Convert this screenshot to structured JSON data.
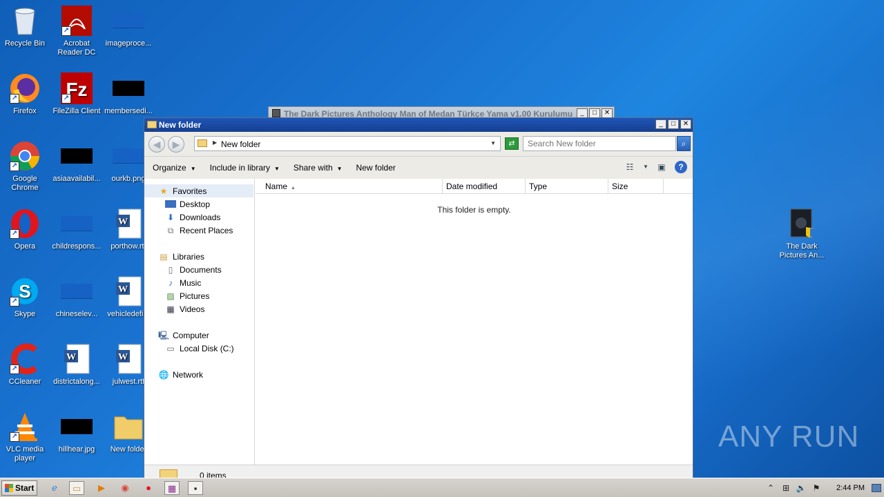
{
  "desktop": {
    "icons": [
      {
        "label": "Recycle Bin",
        "icon": "recycle-bin-icon"
      },
      {
        "label": "Acrobat Reader DC",
        "icon": "acrobat-icon"
      },
      {
        "label": "imageproce...",
        "icon": "file-icon"
      },
      {
        "label": "Firefox",
        "icon": "firefox-icon"
      },
      {
        "label": "FileZilla Client",
        "icon": "filezilla-icon"
      },
      {
        "label": "membersedi...",
        "icon": "file-icon"
      },
      {
        "label": "Google Chrome",
        "icon": "chrome-icon"
      },
      {
        "label": "asiaavailabil...",
        "icon": "file-icon"
      },
      {
        "label": "ourkb.png",
        "icon": "file-icon"
      },
      {
        "label": "Opera",
        "icon": "opera-icon"
      },
      {
        "label": "childrespons...",
        "icon": "file-icon"
      },
      {
        "label": "porthow.rtf",
        "icon": "word-doc-icon"
      },
      {
        "label": "Skype",
        "icon": "skype-icon"
      },
      {
        "label": "chineselev...",
        "icon": "file-icon"
      },
      {
        "label": "vehicledefi...",
        "icon": "word-doc-icon"
      },
      {
        "label": "CCleaner",
        "icon": "ccleaner-icon"
      },
      {
        "label": "districtalong...",
        "icon": "word-doc-icon"
      },
      {
        "label": "julwest.rtf",
        "icon": "word-doc-icon"
      },
      {
        "label": "VLC media player",
        "icon": "vlc-icon"
      },
      {
        "label": "hillhear.jpg",
        "icon": "image-icon"
      },
      {
        "label": "New folder",
        "icon": "folder-icon"
      },
      {
        "label": "The Dark Pictures An...",
        "icon": "installer-icon"
      }
    ],
    "watermark": "ANY RUN"
  },
  "background_window": {
    "title": "The Dark Pictures Anthology Man of Medan Türkçe Yama v1.00 Kurulumu"
  },
  "explorer": {
    "title": "New folder",
    "address": "New folder",
    "search_placeholder": "Search New folder",
    "toolbar": {
      "organize": "Organize",
      "include_in_library": "Include in library",
      "share_with": "Share with",
      "new_folder": "New folder"
    },
    "nav": {
      "favorites": "Favorites",
      "desktop": "Desktop",
      "downloads": "Downloads",
      "recent_places": "Recent Places",
      "libraries": "Libraries",
      "documents": "Documents",
      "music": "Music",
      "pictures": "Pictures",
      "videos": "Videos",
      "computer": "Computer",
      "local_disk": "Local Disk (C:)",
      "network": "Network"
    },
    "columns": {
      "name": "Name",
      "date_modified": "Date modified",
      "type": "Type",
      "size": "Size"
    },
    "empty_message": "This folder is empty.",
    "status_count": "0 items"
  },
  "taskbar": {
    "start_label": "Start",
    "clock": "2:44 PM"
  }
}
